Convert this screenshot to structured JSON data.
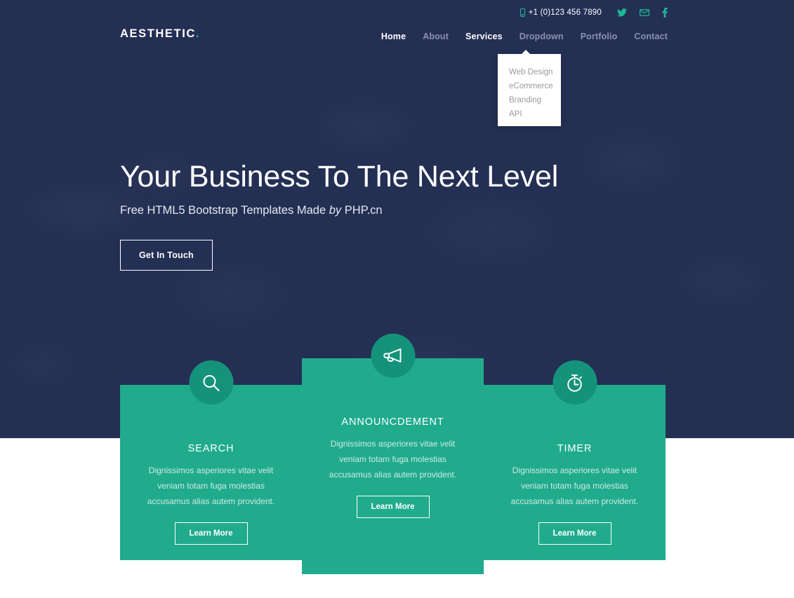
{
  "colors": {
    "hero_bg": "#242f54",
    "accent_teal": "#1db894",
    "card_bg": "#20ab8d",
    "card_icon_bg": "#15937a",
    "nav_inactive": "#8b93ad",
    "dropdown_bg": "#ffffff",
    "page_bg": "#ffffff"
  },
  "topbar": {
    "phone_icon": "mobile-phone-icon",
    "phone": "+1 (0)123 456 7890",
    "social": [
      {
        "name": "twitter-icon",
        "label": "Twitter"
      },
      {
        "name": "email-icon",
        "label": "Email"
      },
      {
        "name": "facebook-icon",
        "label": "Facebook"
      }
    ]
  },
  "header": {
    "logo": "AESTHETIC",
    "logo_dot": ".",
    "nav": [
      {
        "label": "Home",
        "active": true
      },
      {
        "label": "About",
        "active": false
      },
      {
        "label": "Services",
        "active": true
      },
      {
        "label": "Dropdown",
        "active": false
      },
      {
        "label": "Portfolio",
        "active": false
      },
      {
        "label": "Contact",
        "active": false
      }
    ]
  },
  "dropdown": {
    "open_for": "Services",
    "items": [
      {
        "label": "Web Design"
      },
      {
        "label": "eCommerce"
      },
      {
        "label": "Branding"
      },
      {
        "label": "API"
      }
    ]
  },
  "hero": {
    "title": "Your Business To The Next Level",
    "subtitle_lead": "Free HTML5 Bootstrap Templates Made ",
    "subtitle_em": "by",
    "subtitle_tail": " PHP.cn",
    "cta_label": "Get In Touch"
  },
  "services": [
    {
      "id": "search",
      "icon": "search-icon",
      "title": "SEARCH",
      "text": "Dignissimos asperiores vitae velit veniam totam fuga molestias accusamus alias autem provident.",
      "button_label": "Learn More",
      "featured": false
    },
    {
      "id": "announcdement",
      "icon": "megaphone-icon",
      "title": "ANNOUNCDEMENT",
      "text": "Dignissimos asperiores vitae velit veniam totam fuga molestias accusamus alias autem provident.",
      "button_label": "Learn More",
      "featured": true
    },
    {
      "id": "timer",
      "icon": "stopwatch-icon",
      "title": "TIMER",
      "text": "Dignissimos asperiores vitae velit veniam totam fuga molestias accusamus alias autem provident.",
      "button_label": "Learn More",
      "featured": false
    }
  ]
}
